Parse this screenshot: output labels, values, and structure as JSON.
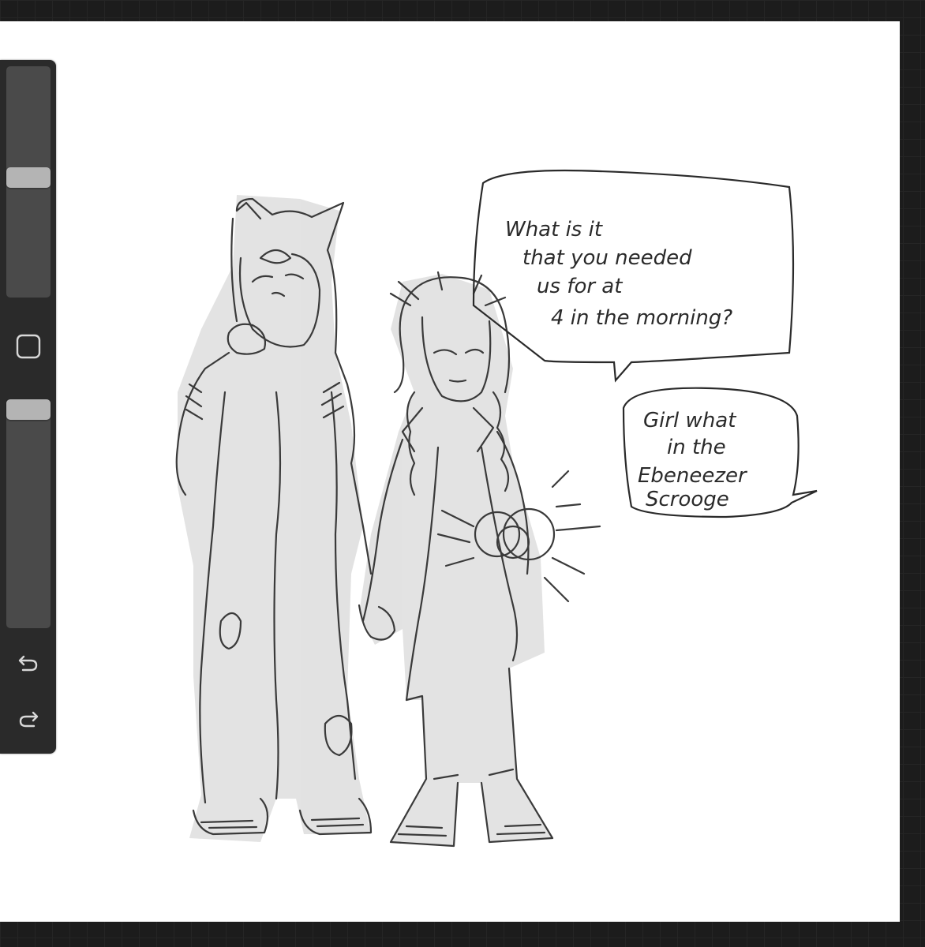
{
  "speech_bubble_1": {
    "lines": [
      "What is it",
      "that you needed",
      "us for at",
      "4 in the morning?"
    ]
  },
  "speech_bubble_2": {
    "lines": [
      "Girl what",
      "in the",
      "Ebeneezer",
      "Scrooge"
    ]
  },
  "sidebar": {
    "brush_size_slider": {
      "value": 0.48
    },
    "brush_opacity_slider": {
      "value": 0.0
    },
    "icons": [
      "square-modify-icon",
      "undo-icon",
      "redo-icon"
    ]
  },
  "colors": {
    "canvas": "#ffffff",
    "background": "#1c1c1c",
    "sidebar": "#2a2a2a",
    "ink": "#2a2a2a"
  }
}
